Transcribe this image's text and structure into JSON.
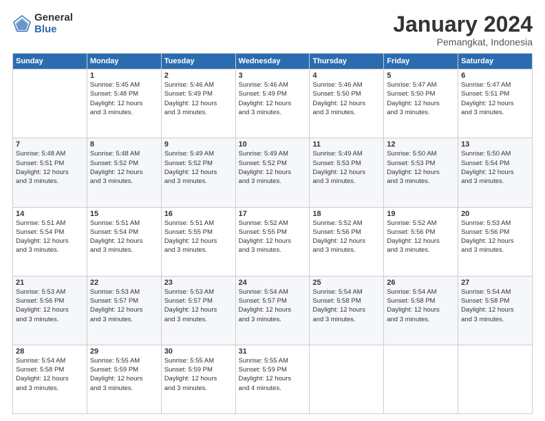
{
  "logo": {
    "general": "General",
    "blue": "Blue"
  },
  "title": "January 2024",
  "subtitle": "Pemangkat, Indonesia",
  "days_header": [
    "Sunday",
    "Monday",
    "Tuesday",
    "Wednesday",
    "Thursday",
    "Friday",
    "Saturday"
  ],
  "weeks": [
    [
      {
        "day": "",
        "info": ""
      },
      {
        "day": "1",
        "sunrise": "5:45 AM",
        "sunset": "5:48 PM",
        "daylight": "12 hours and 3 minutes."
      },
      {
        "day": "2",
        "sunrise": "5:46 AM",
        "sunset": "5:49 PM",
        "daylight": "12 hours and 3 minutes."
      },
      {
        "day": "3",
        "sunrise": "5:46 AM",
        "sunset": "5:49 PM",
        "daylight": "12 hours and 3 minutes."
      },
      {
        "day": "4",
        "sunrise": "5:46 AM",
        "sunset": "5:50 PM",
        "daylight": "12 hours and 3 minutes."
      },
      {
        "day": "5",
        "sunrise": "5:47 AM",
        "sunset": "5:50 PM",
        "daylight": "12 hours and 3 minutes."
      },
      {
        "day": "6",
        "sunrise": "5:47 AM",
        "sunset": "5:51 PM",
        "daylight": "12 hours and 3 minutes."
      }
    ],
    [
      {
        "day": "7",
        "sunrise": "5:48 AM",
        "sunset": "5:51 PM",
        "daylight": "12 hours and 3 minutes."
      },
      {
        "day": "8",
        "sunrise": "5:48 AM",
        "sunset": "5:52 PM",
        "daylight": "12 hours and 3 minutes."
      },
      {
        "day": "9",
        "sunrise": "5:49 AM",
        "sunset": "5:52 PM",
        "daylight": "12 hours and 3 minutes."
      },
      {
        "day": "10",
        "sunrise": "5:49 AM",
        "sunset": "5:52 PM",
        "daylight": "12 hours and 3 minutes."
      },
      {
        "day": "11",
        "sunrise": "5:49 AM",
        "sunset": "5:53 PM",
        "daylight": "12 hours and 3 minutes."
      },
      {
        "day": "12",
        "sunrise": "5:50 AM",
        "sunset": "5:53 PM",
        "daylight": "12 hours and 3 minutes."
      },
      {
        "day": "13",
        "sunrise": "5:50 AM",
        "sunset": "5:54 PM",
        "daylight": "12 hours and 3 minutes."
      }
    ],
    [
      {
        "day": "14",
        "sunrise": "5:51 AM",
        "sunset": "5:54 PM",
        "daylight": "12 hours and 3 minutes."
      },
      {
        "day": "15",
        "sunrise": "5:51 AM",
        "sunset": "5:54 PM",
        "daylight": "12 hours and 3 minutes."
      },
      {
        "day": "16",
        "sunrise": "5:51 AM",
        "sunset": "5:55 PM",
        "daylight": "12 hours and 3 minutes."
      },
      {
        "day": "17",
        "sunrise": "5:52 AM",
        "sunset": "5:55 PM",
        "daylight": "12 hours and 3 minutes."
      },
      {
        "day": "18",
        "sunrise": "5:52 AM",
        "sunset": "5:56 PM",
        "daylight": "12 hours and 3 minutes."
      },
      {
        "day": "19",
        "sunrise": "5:52 AM",
        "sunset": "5:56 PM",
        "daylight": "12 hours and 3 minutes."
      },
      {
        "day": "20",
        "sunrise": "5:53 AM",
        "sunset": "5:56 PM",
        "daylight": "12 hours and 3 minutes."
      }
    ],
    [
      {
        "day": "21",
        "sunrise": "5:53 AM",
        "sunset": "5:56 PM",
        "daylight": "12 hours and 3 minutes."
      },
      {
        "day": "22",
        "sunrise": "5:53 AM",
        "sunset": "5:57 PM",
        "daylight": "12 hours and 3 minutes."
      },
      {
        "day": "23",
        "sunrise": "5:53 AM",
        "sunset": "5:57 PM",
        "daylight": "12 hours and 3 minutes."
      },
      {
        "day": "24",
        "sunrise": "5:54 AM",
        "sunset": "5:57 PM",
        "daylight": "12 hours and 3 minutes."
      },
      {
        "day": "25",
        "sunrise": "5:54 AM",
        "sunset": "5:58 PM",
        "daylight": "12 hours and 3 minutes."
      },
      {
        "day": "26",
        "sunrise": "5:54 AM",
        "sunset": "5:58 PM",
        "daylight": "12 hours and 3 minutes."
      },
      {
        "day": "27",
        "sunrise": "5:54 AM",
        "sunset": "5:58 PM",
        "daylight": "12 hours and 3 minutes."
      }
    ],
    [
      {
        "day": "28",
        "sunrise": "5:54 AM",
        "sunset": "5:58 PM",
        "daylight": "12 hours and 3 minutes."
      },
      {
        "day": "29",
        "sunrise": "5:55 AM",
        "sunset": "5:59 PM",
        "daylight": "12 hours and 3 minutes."
      },
      {
        "day": "30",
        "sunrise": "5:55 AM",
        "sunset": "5:59 PM",
        "daylight": "12 hours and 3 minutes."
      },
      {
        "day": "31",
        "sunrise": "5:55 AM",
        "sunset": "5:59 PM",
        "daylight": "12 hours and 4 minutes."
      },
      {
        "day": "",
        "info": ""
      },
      {
        "day": "",
        "info": ""
      },
      {
        "day": "",
        "info": ""
      }
    ]
  ]
}
